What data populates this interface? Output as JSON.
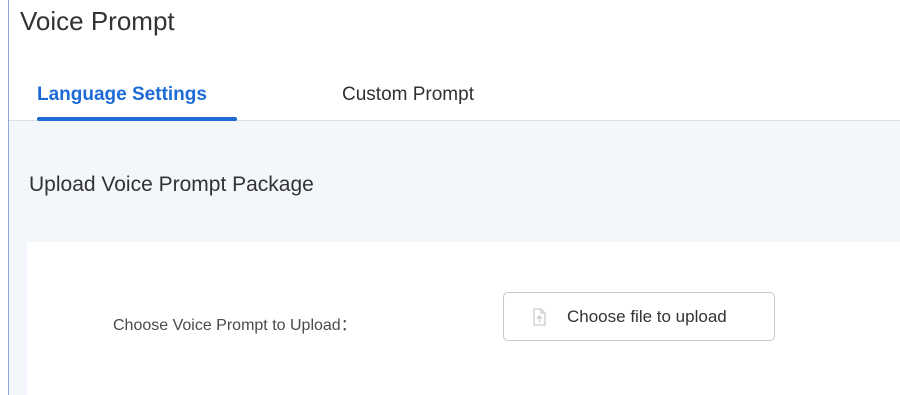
{
  "page": {
    "title": "Voice Prompt"
  },
  "tabs": [
    {
      "label": "Language Settings",
      "active": true
    },
    {
      "label": "Custom Prompt",
      "active": false
    }
  ],
  "section": {
    "title": "Upload Voice Prompt Package",
    "field_label": "Choose Voice Prompt to Upload：",
    "upload_button_label": "Choose file to upload",
    "upload_icon": "upload-icon"
  },
  "colors": {
    "accent": "#1f6bd6",
    "section_background": "#f3f6fa"
  }
}
